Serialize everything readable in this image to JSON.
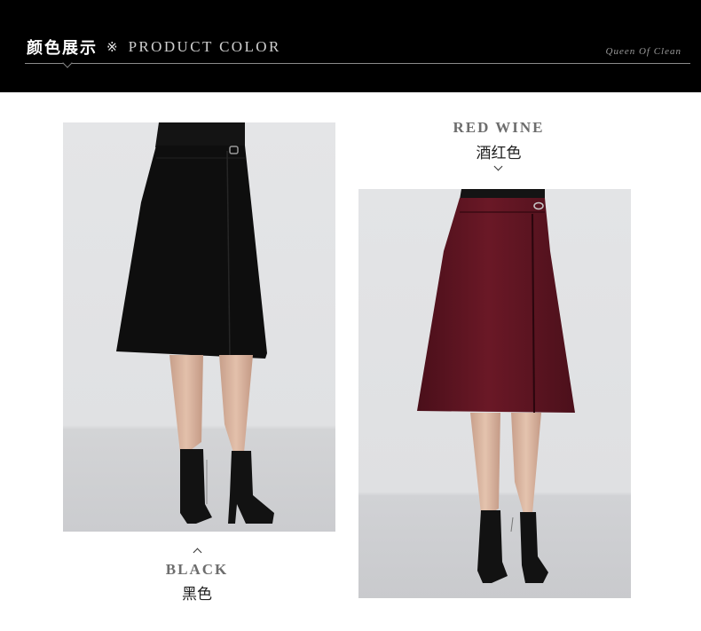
{
  "header": {
    "title_cn": "颜色展示",
    "separator": "※",
    "title_en": "PRODUCT COLOR",
    "brand": "Queen Of Clean"
  },
  "colors": [
    {
      "name_en": "BLACK",
      "name_cn": "黑色",
      "swatch": "#0d0d0d"
    },
    {
      "name_en": "RED WINE",
      "name_cn": "酒红色",
      "swatch": "#5a1320"
    }
  ],
  "icons": {
    "black_label_pointer": "chevron-up-icon",
    "red_label_pointer": "chevron-down-icon"
  }
}
